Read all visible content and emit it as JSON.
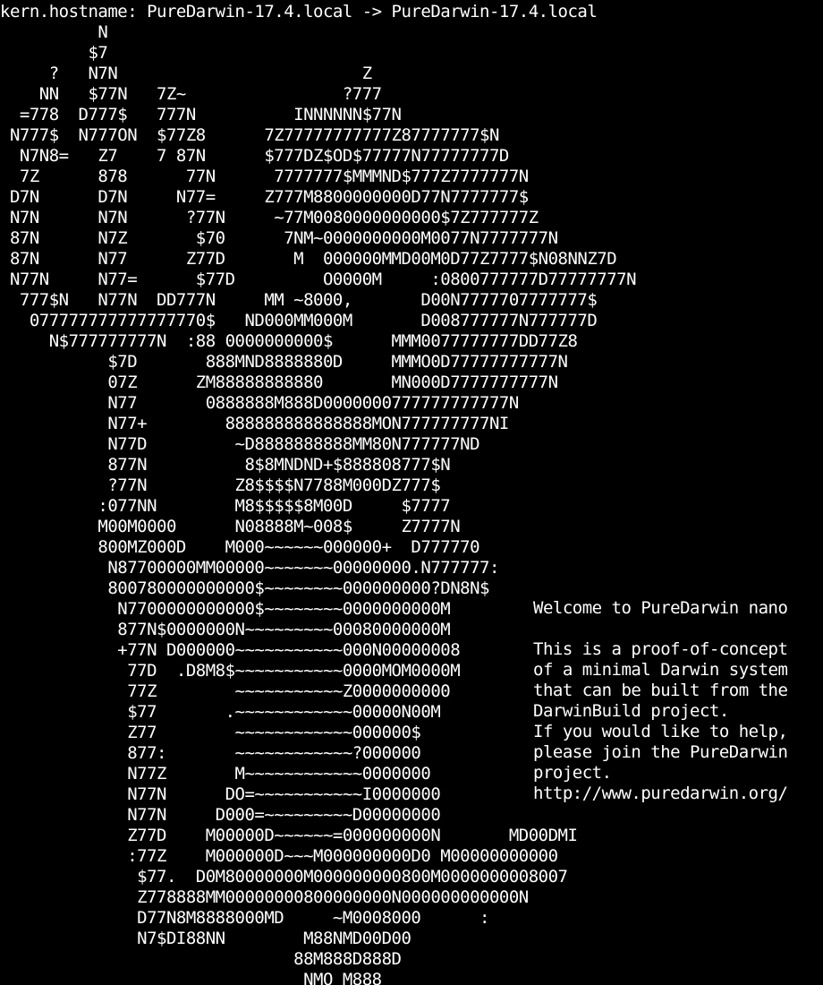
{
  "console": {
    "hostname_line": "kern.hostname: PureDarwin-17.4.local -> PureDarwin-17.4.local",
    "art": [
      "          N",
      "         $7",
      "     ?   N7N                         Z",
      "    NN   $77N   7Z~                ?777",
      "  =778  D777$   777N          INNNNNN$77N",
      " N777$  N777ON  $77Z8      7Z77777777777Z87777777$N",
      "  N7N8=   Z7    7 87N      $777DZ$OD$77777N77777777D",
      "  7Z      878      77N      7777777$MMMND$777Z7777777N",
      " D7N      D7N     N77=     Z777M8800000000D77N7777777$",
      " N7N      N7N      ?77N     ~77M0080000000000$7Z777777Z",
      " 87N      N7Z       $70      7NM~0000000000M0077N7777777N",
      " 87N      N77      Z77D       M  000000MMD00M0D77Z7777$N08NNZ7D",
      " N77N     N77=      $77D         O0000M     :0800777777D77777777N",
      "  777$N   N77N  DD777N     MM ~8000,       D00N7777707777777$",
      "   077777777777777770$   ND000MM000M       D008777777N777777D",
      "     N$777777777N  :88 0000000000$      MMM0077777777DD77Z8",
      "           $7D       888MND8888880D     MMMO0D77777777777N",
      "           07Z      ZM88888888880       MN000D7777777777N",
      "           N77       0888888M888D0000000777777777777N",
      "           N77+        888888888888888MON777777777NI",
      "           N77D         ~D8888888888MM80N777777ND",
      "           877N          8$8MNDND+$888808777$N",
      "           ?77N         Z8$$$$N7788M000DZ777$",
      "          :077NN        M8$$$$$8M00D     $7777",
      "          M00M0000      N08888M~008$     Z7777N",
      "          800MZ000D    M000~~~~~~000000+  D777770",
      "           N87700000MM00000~~~~~~~00000000.N777777:",
      "           800780000000000$~~~~~~~~000000000?DN8N$",
      "            N7700000000000$~~~~~~~~0000000000M",
      "            877N$0000000N~~~~~~~~~00080000000M",
      "            +77N D000000~~~~~~~~~~~000N00000008",
      "             77D  .D8M8$~~~~~~~~~~~0000MOM0000M",
      "             77Z        ~~~~~~~~~~~Z0000000000",
      "             $77       .~~~~~~~~~~~~00000N00M",
      "             Z77        ~~~~~~~~~~~~000000$",
      "             877:       ~~~~~~~~~~~~?000000",
      "             N77Z       M~~~~~~~~~~~~0000000",
      "             N77N      DO=~~~~~~~~~~~I0000000",
      "             N77N     D000=~~~~~~~~~D00000000",
      "             Z77D    M00000D~~~~~~=000000000N       MD00DMI",
      "             :77Z    M000000D~~~M000000000D0 M00000000000",
      "              $77.  D0M80000000M000000000800M0000000008007",
      "              Z778888MM00000000800000000N000000000000N",
      "              D77N8M8888000MD     ~M0008000      :",
      "              N7$DI88NN        M88NMD00D00",
      "                              88M888D888D",
      "                               NMO M888"
    ],
    "welcome": {
      "title": "Welcome to PureDarwin nano",
      "lines": [
        "This is a proof-of-concept",
        "of a minimal Darwin system",
        "that can be built from the",
        "DarwinBuild project.",
        "If you would like to help,",
        "please join the PureDarwin",
        "project.",
        "http://www.puredarwin.org/"
      ]
    },
    "colors": {
      "background": "#000000",
      "foreground": "#ffffff"
    }
  }
}
